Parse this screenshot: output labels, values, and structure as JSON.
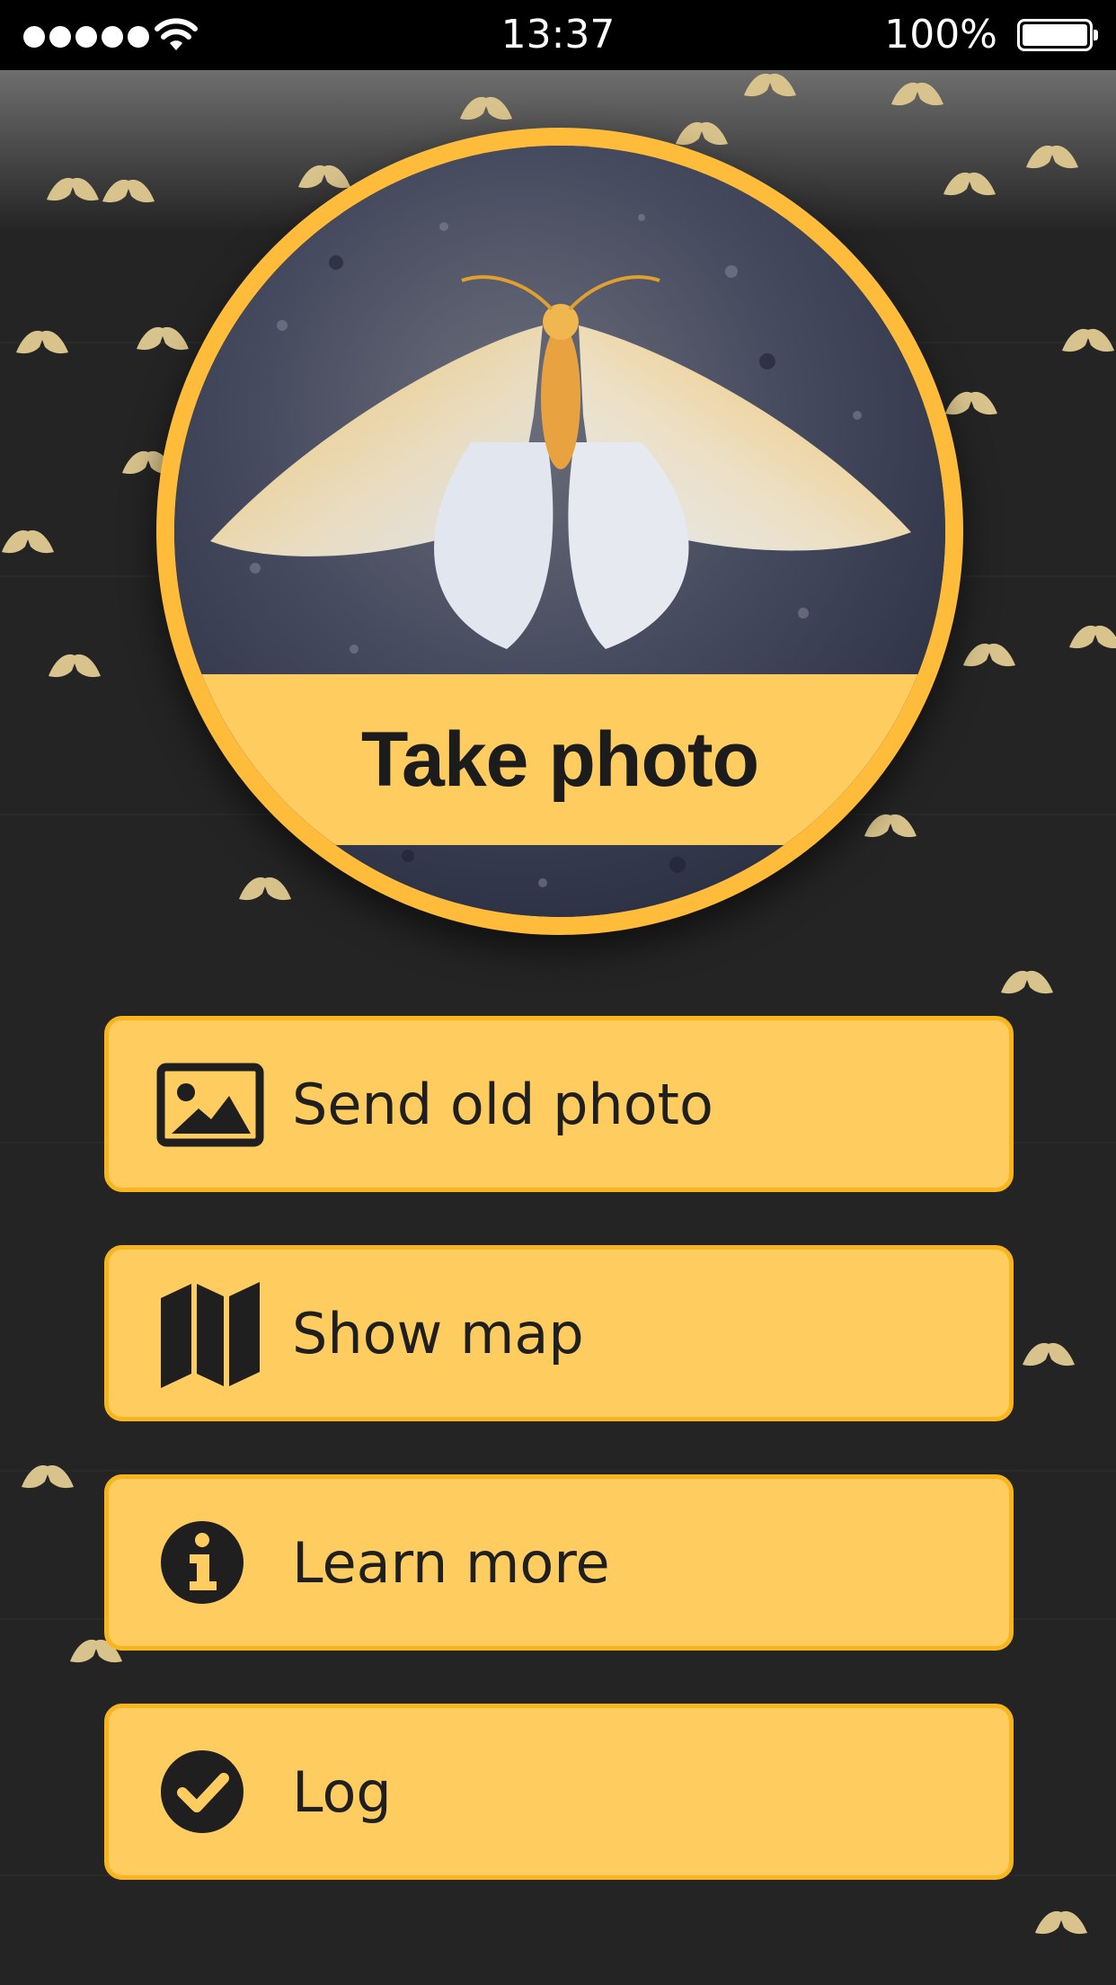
{
  "status_bar": {
    "time": "13:37",
    "battery_text": "100%",
    "battery_level": 1.0,
    "signal_bars": 5
  },
  "hero": {
    "label": "Take photo",
    "icon": "moth-photo"
  },
  "menu": [
    {
      "label": "Send old photo",
      "icon": "image-icon"
    },
    {
      "label": "Show map",
      "icon": "map-icon"
    },
    {
      "label": "Learn more",
      "icon": "info-icon"
    },
    {
      "label": "Log",
      "icon": "check-icon"
    }
  ],
  "colors": {
    "background": "#242424",
    "accent": "#fecc5f",
    "accent_border": "#f9b51d",
    "moth_silhouette": "#d9c38c"
  }
}
